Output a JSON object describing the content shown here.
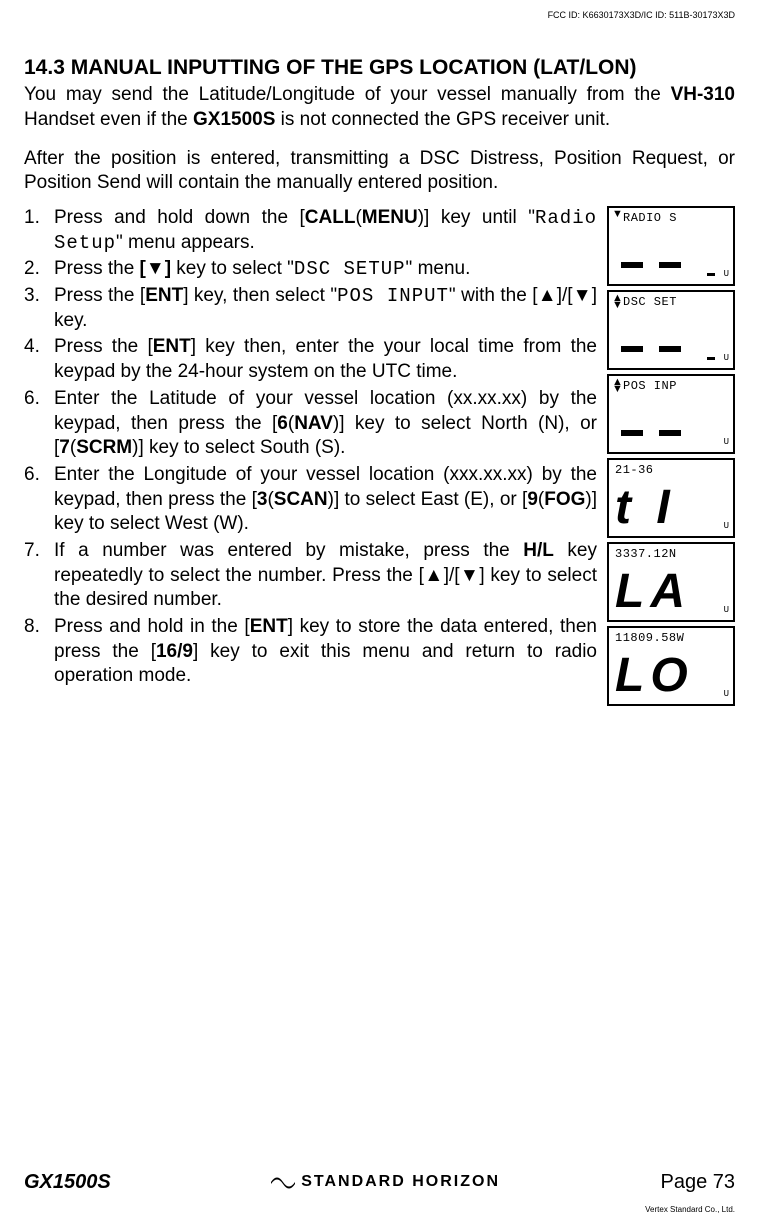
{
  "fcc": "FCC ID: K6630173X3D/IC ID: 511B-30173X3D",
  "section_title_prefix": "14.3  MANUAL INPUTTING OF THE GPS LOCATION ",
  "section_title_paren": "(",
  "section_title_inner": "LAT/LON",
  "section_title_close": ")",
  "intro": {
    "a": "You may send the Latitude/Longitude of your vessel manually from the ",
    "vh310": "VH-310",
    "b": " Handset even if the ",
    "gx1500s": "GX1500S",
    "c": " is not connected the GPS receiver unit."
  },
  "intro2": "After the position is entered, transmitting a DSC Distress, Position Request, or Position Send will contain the manually entered position.",
  "steps": [
    {
      "num": "1.",
      "parts": [
        "Press and hold down the [",
        "CALL",
        "(",
        "MENU",
        ")] key until \"",
        "Radio Setup",
        "\" menu appears."
      ]
    },
    {
      "num": "2.",
      "parts": [
        "Press the ",
        "[",
        "▼",
        "]",
        " key to select \"",
        "DSC SETUP",
        "\" menu."
      ]
    },
    {
      "num": "3.",
      "parts": [
        "Press the [",
        "ENT",
        "] key, then select \"",
        "POS INPUT",
        "\" with the [",
        "▲",
        "]/[",
        "▼",
        "] key."
      ]
    },
    {
      "num": "4.",
      "parts": [
        "Press the [",
        "ENT",
        "] key then, enter the your local time from the keypad by the 24-hour system on the UTC time."
      ]
    },
    {
      "num": "6.",
      "parts": [
        "Enter the Latitude of your vessel location (xx.xx.xx) by the keypad, then press the [",
        "6",
        "(",
        "NAV",
        ")] key to select North (N), or [",
        "7",
        "(",
        "SCRM",
        ")] key to select South (S)."
      ]
    },
    {
      "num": "6.",
      "parts": [
        "Enter the Longitude of your vessel location (xxx.xx.xx) by the keypad, then press the [",
        "3",
        "(",
        "SCAN",
        ")] to select East (E), or [",
        "9",
        "(",
        "FOG",
        ")] key to select West (W)."
      ]
    },
    {
      "num": "7.",
      "parts": [
        "If a number was entered by mistake, press the ",
        "H/L",
        " key repeatedly to select the number. Press the [",
        "▲",
        "]/[",
        "▼",
        "] key to select the desired number."
      ]
    },
    {
      "num": "8.",
      "parts": [
        "Press and hold in the [",
        "ENT",
        "] key to store the data entered, then press the [",
        "16/9",
        "] key to exit this menu and return to radio operation mode."
      ]
    }
  ],
  "screens": [
    {
      "top": "RADIO S",
      "arrow_mode": "down",
      "body_type": "dashes",
      "small_dash": true
    },
    {
      "top": "DSC  SET",
      "arrow_mode": "both",
      "body_type": "dashes",
      "small_dash": true
    },
    {
      "top": "POS  INP",
      "arrow_mode": "both",
      "body_type": "dashes",
      "small_dash": false
    },
    {
      "top": "21-36",
      "arrow_mode": "none",
      "body_type": "big",
      "big": "t I"
    },
    {
      "top": "3337.12N",
      "arrow_mode": "none",
      "body_type": "big",
      "big": "LA"
    },
    {
      "top": "11809.58W",
      "arrow_mode": "none",
      "body_type": "big",
      "big": "LO"
    }
  ],
  "u_mark": "U",
  "footer": {
    "model": "GX1500S",
    "brand": "STANDARD HORIZON",
    "page": "Page 73"
  },
  "vertex": "Vertex Standard Co., Ltd."
}
